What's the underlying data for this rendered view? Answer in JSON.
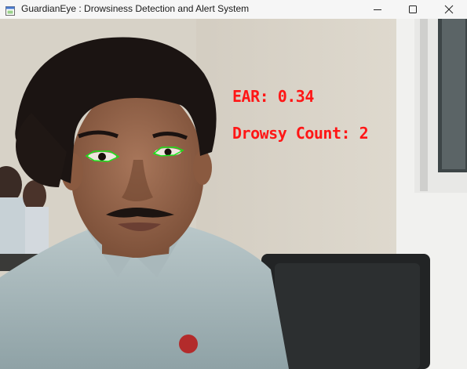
{
  "window": {
    "title": "GuardianEye : Drowsiness Detection and Alert System",
    "icons": {
      "app": "app-window-icon",
      "minimize": "minimize-icon",
      "maximize": "maximize-icon",
      "close": "close-icon"
    }
  },
  "camera": {
    "overlay_color": "#ff1616",
    "eye_contour_color": "#19e619",
    "ear_label": "EAR: 0.34",
    "drowsy_label": "Drowsy Count: 2"
  }
}
